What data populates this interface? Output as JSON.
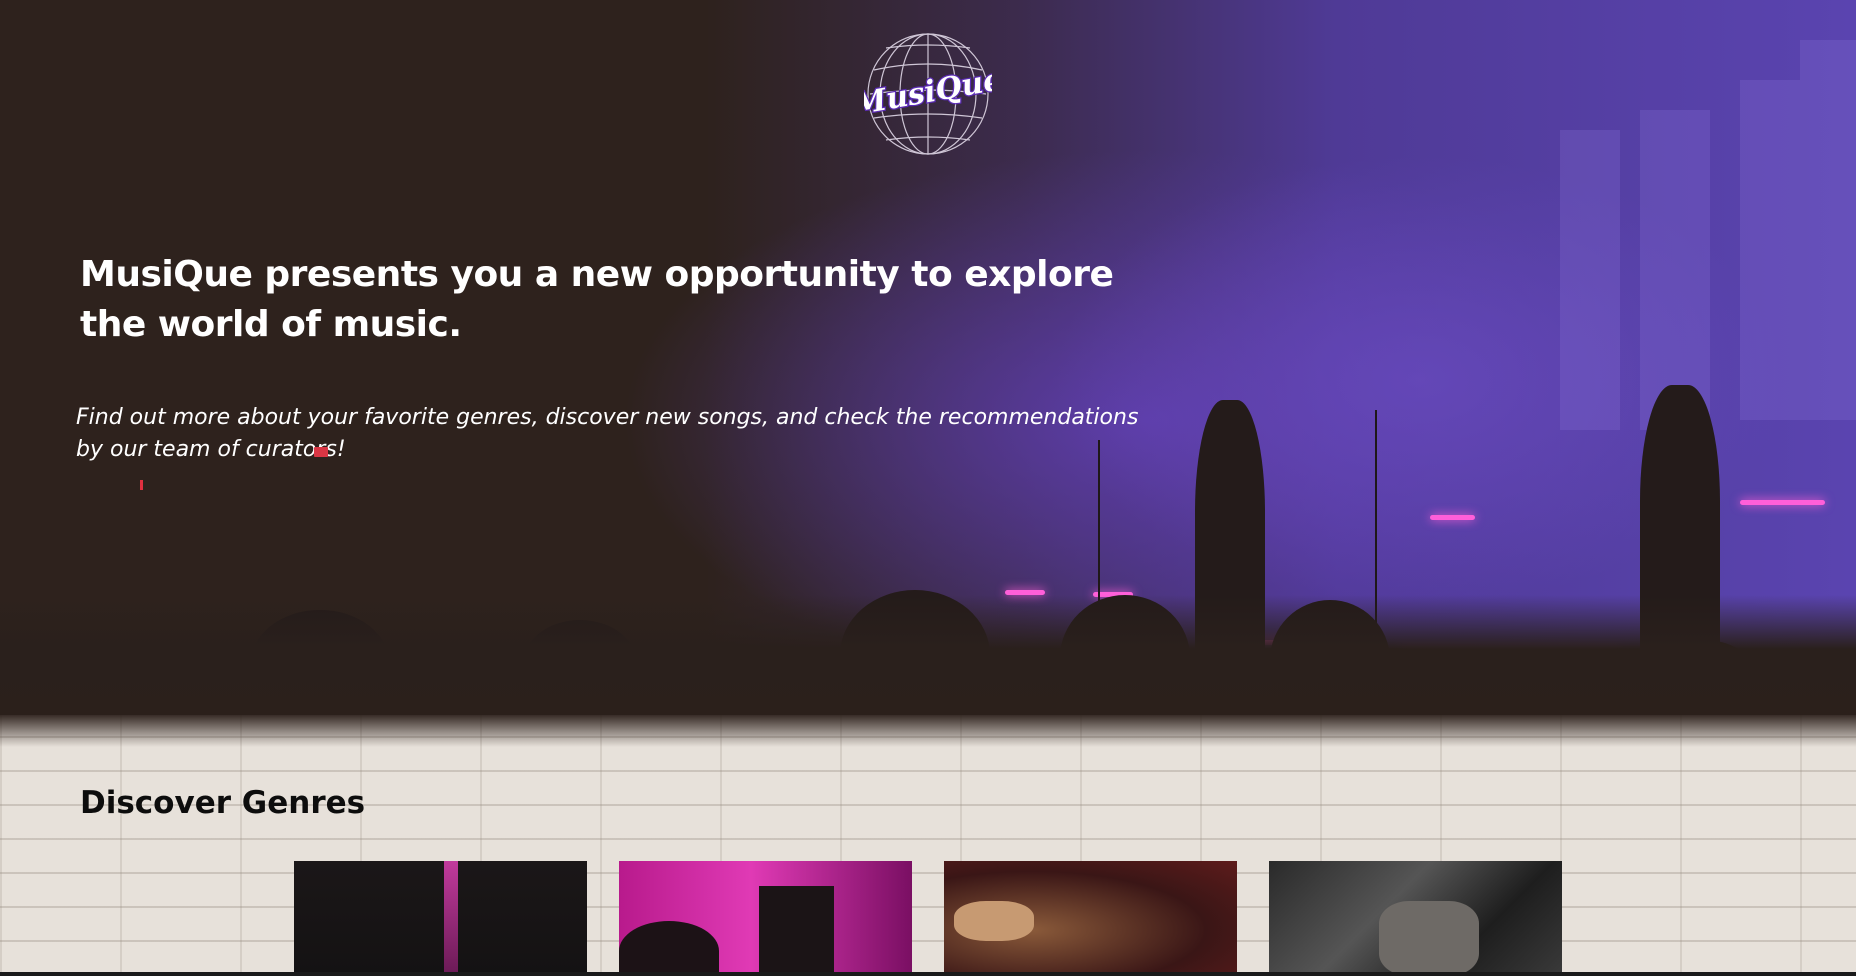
{
  "brand": {
    "logo_text": "MusiQue"
  },
  "hero": {
    "title": "MusiQue presents you a new opportunity to explore the world of music.",
    "subtitle": "Find out more about your favorite genres, discover new songs, and check the recommendations by our team of curators!"
  },
  "genres": {
    "heading": "Discover Genres",
    "cards": [
      {
        "icon": "guitar-image"
      },
      {
        "icon": "stage-pink-image"
      },
      {
        "icon": "trumpet-image"
      },
      {
        "icon": "guitarist-image"
      }
    ]
  },
  "colors": {
    "hero_dark": "#2e221d",
    "hero_purple": "#5a44b0",
    "accent_pink": "#ff5fd9",
    "logo_purple": "#5b2bb5"
  }
}
